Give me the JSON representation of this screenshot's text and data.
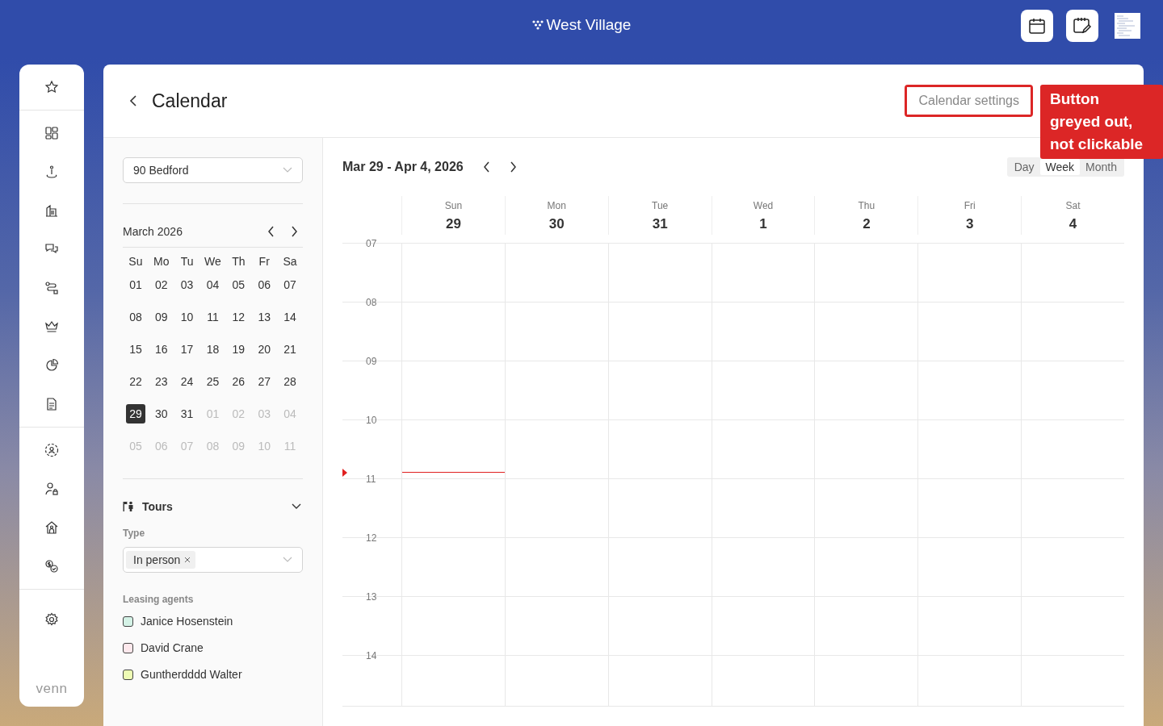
{
  "topbar": {
    "brand": "West Village"
  },
  "page": {
    "title": "Calendar",
    "settings_button": {
      "label": "Calendar settings",
      "disabled": true
    }
  },
  "annotation": {
    "text": "Button greyed out, not clickable"
  },
  "filters": {
    "property": {
      "value": "90 Bedford"
    },
    "mini_calendar": {
      "month": "March 2026",
      "weekdays": [
        "Su",
        "Mo",
        "Tu",
        "We",
        "Th",
        "Fr",
        "Sa"
      ],
      "weeks": [
        [
          {
            "label": "01",
            "muted": false,
            "selected": false
          },
          {
            "label": "02",
            "muted": false,
            "selected": false
          },
          {
            "label": "03",
            "muted": false,
            "selected": false
          },
          {
            "label": "04",
            "muted": false,
            "selected": false
          },
          {
            "label": "05",
            "muted": false,
            "selected": false
          },
          {
            "label": "06",
            "muted": false,
            "selected": false
          },
          {
            "label": "07",
            "muted": false,
            "selected": false
          }
        ],
        [
          {
            "label": "08",
            "muted": false,
            "selected": false
          },
          {
            "label": "09",
            "muted": false,
            "selected": false
          },
          {
            "label": "10",
            "muted": false,
            "selected": false
          },
          {
            "label": "11",
            "muted": false,
            "selected": false
          },
          {
            "label": "12",
            "muted": false,
            "selected": false
          },
          {
            "label": "13",
            "muted": false,
            "selected": false
          },
          {
            "label": "14",
            "muted": false,
            "selected": false
          }
        ],
        [
          {
            "label": "15",
            "muted": false,
            "selected": false
          },
          {
            "label": "16",
            "muted": false,
            "selected": false
          },
          {
            "label": "17",
            "muted": false,
            "selected": false
          },
          {
            "label": "18",
            "muted": false,
            "selected": false
          },
          {
            "label": "19",
            "muted": false,
            "selected": false
          },
          {
            "label": "20",
            "muted": false,
            "selected": false
          },
          {
            "label": "21",
            "muted": false,
            "selected": false
          }
        ],
        [
          {
            "label": "22",
            "muted": false,
            "selected": false
          },
          {
            "label": "23",
            "muted": false,
            "selected": false
          },
          {
            "label": "24",
            "muted": false,
            "selected": false
          },
          {
            "label": "25",
            "muted": false,
            "selected": false
          },
          {
            "label": "26",
            "muted": false,
            "selected": false
          },
          {
            "label": "27",
            "muted": false,
            "selected": false
          },
          {
            "label": "28",
            "muted": false,
            "selected": false
          }
        ],
        [
          {
            "label": "29",
            "muted": false,
            "selected": true
          },
          {
            "label": "30",
            "muted": false,
            "selected": false
          },
          {
            "label": "31",
            "muted": false,
            "selected": false
          },
          {
            "label": "01",
            "muted": true,
            "selected": false
          },
          {
            "label": "02",
            "muted": true,
            "selected": false
          },
          {
            "label": "03",
            "muted": true,
            "selected": false
          },
          {
            "label": "04",
            "muted": true,
            "selected": false
          }
        ],
        [
          {
            "label": "05",
            "muted": true,
            "selected": false
          },
          {
            "label": "06",
            "muted": true,
            "selected": false
          },
          {
            "label": "07",
            "muted": true,
            "selected": false
          },
          {
            "label": "08",
            "muted": true,
            "selected": false
          },
          {
            "label": "09",
            "muted": true,
            "selected": false
          },
          {
            "label": "10",
            "muted": true,
            "selected": false
          },
          {
            "label": "11",
            "muted": true,
            "selected": false
          }
        ]
      ]
    },
    "tours": {
      "title": "Tours",
      "expanded": true,
      "type_label": "Type",
      "type_tags": [
        "In person"
      ],
      "agents_label": "Leasing agents",
      "agents": [
        {
          "name": "Janice Hosenstein",
          "color": "#d4f2e6"
        },
        {
          "name": "David Crane",
          "color": "#fde8ec"
        },
        {
          "name": "Guntherdddd Walter",
          "color": "#eefcb4"
        }
      ]
    }
  },
  "calendar": {
    "range": "Mar 29 - Apr 4, 2026",
    "view_options": [
      {
        "label": "Day",
        "selected": false
      },
      {
        "label": "Week",
        "selected": true
      },
      {
        "label": "Month",
        "selected": false
      }
    ],
    "days": [
      {
        "name": "Sun",
        "date": "29"
      },
      {
        "name": "Mon",
        "date": "30"
      },
      {
        "name": "Tue",
        "date": "31"
      },
      {
        "name": "Wed",
        "date": "1"
      },
      {
        "name": "Thu",
        "date": "2"
      },
      {
        "name": "Fri",
        "date": "3"
      },
      {
        "name": "Sat",
        "date": "4"
      }
    ],
    "hours": [
      "07",
      "08",
      "09",
      "10",
      "11",
      "12",
      "13",
      "14"
    ]
  },
  "sidebar": {
    "logo": "venn"
  }
}
